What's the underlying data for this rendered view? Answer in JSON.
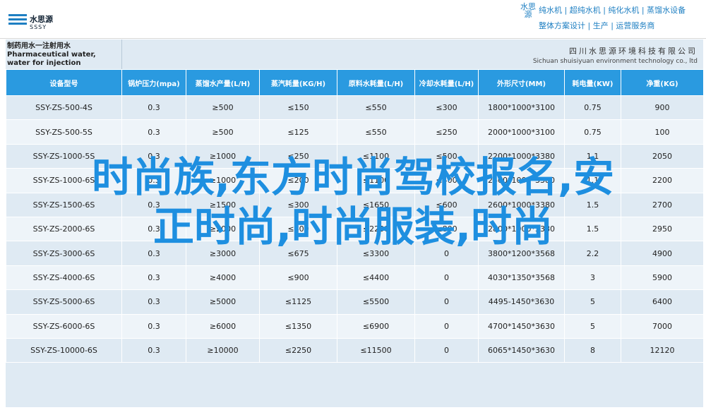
{
  "header": {
    "logo_cn": "水思源",
    "logo_en": "SSSY",
    "brand_vertical": "水思源",
    "brand_line1": "纯水机 | 超纯水机 | 纯化水机 | 蒸馏水设备",
    "brand_line2": "整体方案设计 | 生产 | 运营服务商"
  },
  "document": {
    "title": "制药用水一注射用水 Pharmaceutical water, water for injection",
    "company_cn": "四川水思源环境科技有限公司",
    "company_en": "Sichuan shuisiyuan environment technology co., ltd"
  },
  "table": {
    "headers": [
      "设备型号",
      "锅炉压力(mpa)",
      "蒸馏水产量(L/H)",
      "蒸汽耗量(KG/H)",
      "原料水耗量(L/H)",
      "冷却水耗量(L/H)",
      "外形尺寸(MM)",
      "耗电量(KW)",
      "净重(KG)"
    ],
    "rows": [
      [
        "SSY-ZS-500-4S",
        "0.3",
        "≥500",
        "≤150",
        "≤550",
        "≤300",
        "1800*1000*3100",
        "0.75",
        "900"
      ],
      [
        "SSY-ZS-500-5S",
        "0.3",
        "≥500",
        "≤125",
        "≤550",
        "≤250",
        "2000*1000*3100",
        "0.75",
        "100"
      ],
      [
        "SSY-ZS-1000-5S",
        "0.3",
        "≥1000",
        "≤250",
        "≤1100",
        "≤500",
        "2200*1000*3380",
        "1.1",
        "2050"
      ],
      [
        "SSY-ZS-1000-6S",
        "0.3",
        "≥1000",
        "≤200",
        "≤1100",
        "≤400",
        "2400*1000*3380",
        "1.1",
        "2200"
      ],
      [
        "SSY-ZS-1500-6S",
        "0.3",
        "≥1500",
        "≤300",
        "≤1650",
        "≤600",
        "2600*1000*3380",
        "1.5",
        "2700"
      ],
      [
        "SSY-ZS-2000-6S",
        "0.3",
        "≥2000",
        "≤400",
        "≤2200",
        "≤800",
        "2800*1000*3380",
        "1.5",
        "2950"
      ],
      [
        "SSY-ZS-3000-6S",
        "0.3",
        "≥3000",
        "≤675",
        "≤3300",
        "0",
        "3800*1200*3568",
        "2.2",
        "4900"
      ],
      [
        "SSY-ZS-4000-6S",
        "0.3",
        "≥4000",
        "≤900",
        "≤4400",
        "0",
        "4030*1350*3568",
        "3",
        "5900"
      ],
      [
        "SSY-ZS-5000-6S",
        "0.3",
        "≥5000",
        "≤1125",
        "≤5500",
        "0",
        "4495-1450*3630",
        "5",
        "6400"
      ],
      [
        "SSY-ZS-6000-6S",
        "0.3",
        "≥6000",
        "≤1350",
        "≤6900",
        "0",
        "4700*1450*3630",
        "5",
        "7000"
      ],
      [
        "SSY-ZS-10000-6S",
        "0.3",
        "≥10000",
        "≤2250",
        "≤11500",
        "0",
        "6065*1450*3630",
        "8",
        "12120"
      ]
    ]
  },
  "overlay": {
    "line1": "时尚族,东方时尚驾校报名,安",
    "line2": "正时尚,时尚服装,时尚"
  }
}
